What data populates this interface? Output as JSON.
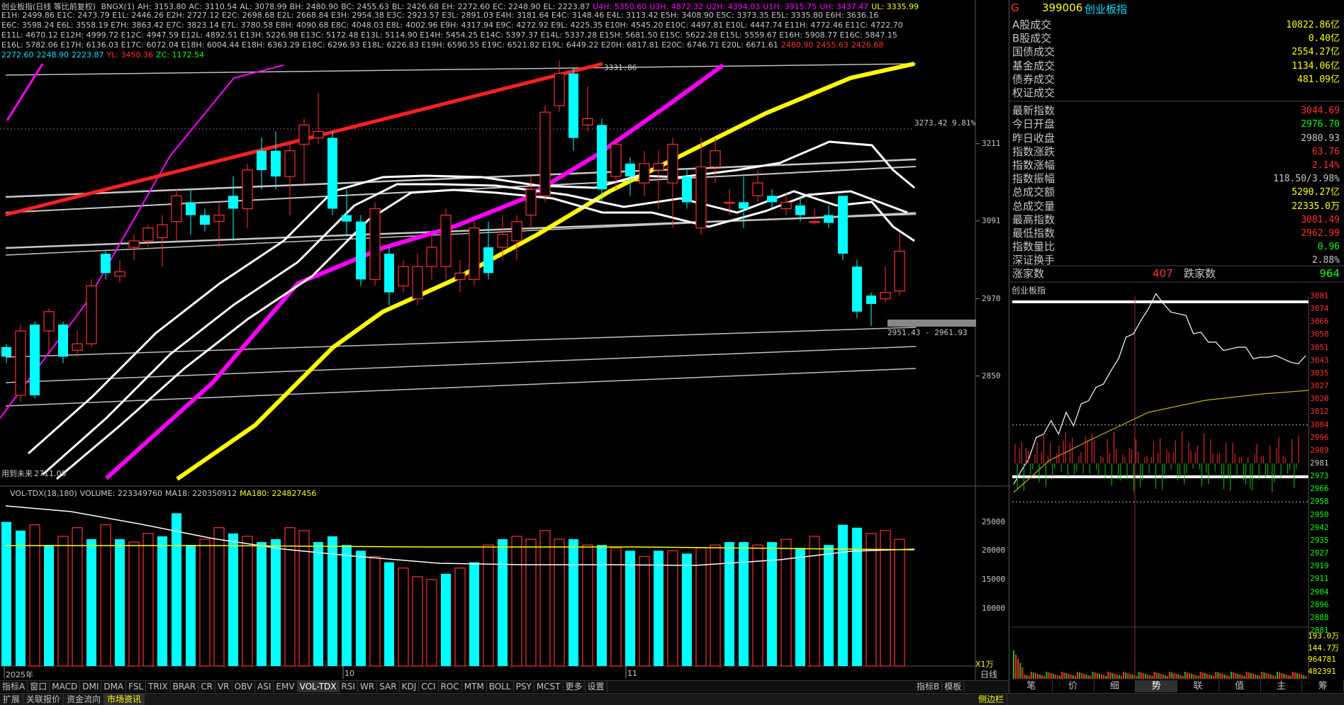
{
  "header": {
    "title": "创业板指(日线 等比前复权)",
    "line1": [
      {
        "t": "BNGX(1)",
        "c": "#c8c8c8"
      },
      {
        "t": "AH: 3153.80",
        "c": "#c8c8c8"
      },
      {
        "t": "AC: 3110.54",
        "c": "#c8c8c8"
      },
      {
        "t": "AL: 3078.99",
        "c": "#c8c8c8"
      },
      {
        "t": "BH: 2480.90",
        "c": "#c8c8c8"
      },
      {
        "t": "BC: 2455.63",
        "c": "#c8c8c8"
      },
      {
        "t": "BL: 2426.68",
        "c": "#c8c8c8"
      },
      {
        "t": "EH: 2272.60",
        "c": "#c8c8c8"
      },
      {
        "t": "EC: 2248.90",
        "c": "#c8c8c8"
      },
      {
        "t": "EL: 2223.87",
        "c": "#c8c8c8"
      },
      {
        "t": "U4H: 5350.60",
        "c": "#ff00ff"
      },
      {
        "t": "U3H: 4872.32",
        "c": "#ff00ff"
      },
      {
        "t": "U2H: 4394.03",
        "c": "#ff00ff"
      },
      {
        "t": "U1H: 3915.75",
        "c": "#ff00ff"
      },
      {
        "t": "UH: 3437.47",
        "c": "#ff00ff"
      },
      {
        "t": "UL: 3335.99",
        "c": "#ffff00"
      }
    ],
    "line2": "E1H: 2499.86 E1C: 2473.79 E1L: 2446.26 E2H: 2727.12 E2C: 2698.68 E2L: 2668.84 E3H: 2954.38 E3C: 2923.57 E3L: 2891.03 E4H: 3181.64 E4C: 3148.46 E4L: 3113.42 E5H: 3408.90 E5C: 3373.35 E5L: 3335.80 E6H: 3636.16",
    "line3": "E6C: 3598.24 E6L: 3558.19 E7H: 3863.42 E7C: 3823.14 E7L: 3780.58 E8H: 4090.68 E8C: 4048.03 E8L: 4002.96 E9H: 4317.94 E9C: 4272.92 E9L: 4225.35 E10H: 4545.20 E10C: 4497.81 E10L: 4447.74 E11H: 4772.46 E11C: 4722.70",
    "line4": "E11L: 4670.12 E12H: 4999.72 E12C: 4947.59 E12L: 4892.51 E13H: 5226.98 E13C: 5172.48 E13L: 5114.90 E14H: 5454.25 E14C: 5397.37 E14L: 5337.28 E15H: 5681.50 E15C: 5622.28 E15L: 5559.67 E16H: 5908.77 E16C: 5847.15",
    "line5": "E16L: 5782.06 E17H: 6136.03 E17C: 6072.04 E18H: 6004.44 E18H: 6363.29 E18C: 6296.93 E18L: 6226.83 E19H: 6590.55 E19C: 6521.82 E19L: 6449.22 E20H: 6817.81 E20C: 6746.71 E20L: 6671.61",
    "line5_tail": [
      {
        "t": "2480.90",
        "c": "#ff3030"
      },
      {
        "t": "2455.63",
        "c": "#ff3030"
      },
      {
        "t": "2426.68",
        "c": "#ff3030"
      }
    ],
    "line6": [
      {
        "t": "2272.60",
        "c": "#00e0ff"
      },
      {
        "t": "2248.90",
        "c": "#00e0ff"
      },
      {
        "t": "2223.87",
        "c": "#00e0ff"
      },
      {
        "t": "YL: 3450.36",
        "c": "#ff3030"
      },
      {
        "t": "ZC: 1172.54",
        "c": "#00ff00"
      }
    ]
  },
  "price_axis": [
    "3211",
    "3091",
    "2970",
    "2850"
  ],
  "annotations": {
    "high_label": "3331.86",
    "target_label": "3273.42 9.81%",
    "range_label": "2951.43 - 2961.93",
    "left_note": "用到未来",
    "left_value": "2711.08"
  },
  "volume": {
    "header": [
      {
        "t": "VOL-TDX(18,180)",
        "c": "#c8c8c8"
      },
      {
        "t": "VOLUME: 223349760",
        "c": "#c8c8c8"
      },
      {
        "t": "MA18: 220350912",
        "c": "#c8c8c8"
      },
      {
        "t": "MA180: 224827456",
        "c": "#ffff00"
      }
    ],
    "axis": [
      "25000",
      "20000",
      "15000",
      "10000"
    ],
    "unit": "X1万"
  },
  "date_axis": [
    "2025年",
    "10",
    "11"
  ],
  "candles": [
    {
      "o": 2895,
      "c": 2880,
      "h": 2900,
      "l": 2870
    },
    {
      "o": 2820,
      "c": 2920,
      "h": 2930,
      "l": 2810
    },
    {
      "o": 2930,
      "c": 2820,
      "h": 2935,
      "l": 2815
    },
    {
      "o": 2920,
      "c": 2950,
      "h": 2955,
      "l": 2885
    },
    {
      "o": 2930,
      "c": 2880,
      "h": 2935,
      "l": 2870
    },
    {
      "o": 2890,
      "c": 2900,
      "h": 2920,
      "l": 2880
    },
    {
      "o": 2900,
      "c": 2990,
      "h": 3000,
      "l": 2895
    },
    {
      "o": 3040,
      "c": 3010,
      "h": 3045,
      "l": 3000
    },
    {
      "o": 3005,
      "c": 3012,
      "h": 3030,
      "l": 2995
    },
    {
      "o": 3050,
      "c": 3060,
      "h": 3070,
      "l": 3030
    },
    {
      "o": 3060,
      "c": 3080,
      "h": 3085,
      "l": 3050
    },
    {
      "o": 3065,
      "c": 3085,
      "h": 3100,
      "l": 3020
    },
    {
      "o": 3090,
      "c": 3130,
      "h": 3140,
      "l": 3060
    },
    {
      "o": 3120,
      "c": 3100,
      "h": 3140,
      "l": 3070
    },
    {
      "o": 3100,
      "c": 3085,
      "h": 3110,
      "l": 3075
    },
    {
      "o": 3090,
      "c": 3100,
      "h": 3120,
      "l": 3050
    },
    {
      "o": 3130,
      "c": 3110,
      "h": 3160,
      "l": 3060
    },
    {
      "o": 3110,
      "c": 3170,
      "h": 3180,
      "l": 3080
    },
    {
      "o": 3200,
      "c": 3170,
      "h": 3220,
      "l": 3140
    },
    {
      "o": 3200,
      "c": 3160,
      "h": 3230,
      "l": 3140
    },
    {
      "o": 3160,
      "c": 3200,
      "h": 3210,
      "l": 3100
    },
    {
      "o": 3210,
      "c": 3240,
      "h": 3250,
      "l": 3150
    },
    {
      "o": 3220,
      "c": 3230,
      "h": 3290,
      "l": 3210
    },
    {
      "o": 3220,
      "c": 3110,
      "h": 3230,
      "l": 3100
    },
    {
      "o": 3100,
      "c": 3090,
      "h": 3140,
      "l": 3070
    },
    {
      "o": 3090,
      "c": 3000,
      "h": 3100,
      "l": 2990
    },
    {
      "o": 3000,
      "c": 3110,
      "h": 3120,
      "l": 2990
    },
    {
      "o": 3040,
      "c": 2980,
      "h": 3050,
      "l": 2960
    },
    {
      "o": 2990,
      "c": 3020,
      "h": 3030,
      "l": 2980
    },
    {
      "o": 2970,
      "c": 3020,
      "h": 3040,
      "l": 2960
    },
    {
      "o": 3020,
      "c": 3050,
      "h": 3070,
      "l": 3000
    },
    {
      "o": 3020,
      "c": 3100,
      "h": 3110,
      "l": 3000
    },
    {
      "o": 3000,
      "c": 3010,
      "h": 3030,
      "l": 2980
    },
    {
      "o": 3000,
      "c": 3080,
      "h": 3090,
      "l": 2990
    },
    {
      "o": 3050,
      "c": 3010,
      "h": 3090,
      "l": 3000
    },
    {
      "o": 3050,
      "c": 3070,
      "h": 3100,
      "l": 3030
    },
    {
      "o": 3060,
      "c": 3090,
      "h": 3100,
      "l": 3030
    },
    {
      "o": 3100,
      "c": 3140,
      "h": 3160,
      "l": 3080
    },
    {
      "o": 3130,
      "c": 3260,
      "h": 3270,
      "l": 3120
    },
    {
      "o": 3270,
      "c": 3320,
      "h": 3340,
      "l": 3260
    },
    {
      "o": 3320,
      "c": 3220,
      "h": 3330,
      "l": 3200
    },
    {
      "o": 3240,
      "c": 3250,
      "h": 3300,
      "l": 3230
    },
    {
      "o": 3240,
      "c": 3140,
      "h": 3250,
      "l": 3120
    },
    {
      "o": 3160,
      "c": 3210,
      "h": 3220,
      "l": 3140
    },
    {
      "o": 3180,
      "c": 3160,
      "h": 3190,
      "l": 3130
    },
    {
      "o": 3150,
      "c": 3180,
      "h": 3200,
      "l": 3130
    },
    {
      "o": 3170,
      "c": 3180,
      "h": 3200,
      "l": 3110
    },
    {
      "o": 3150,
      "c": 3210,
      "h": 3220,
      "l": 3080
    },
    {
      "o": 3160,
      "c": 3120,
      "h": 3170,
      "l": 3110
    },
    {
      "o": 3080,
      "c": 3175,
      "h": 3220,
      "l": 3070
    },
    {
      "o": 3175,
      "c": 3200,
      "h": 3220,
      "l": 3150
    },
    {
      "o": 3120,
      "c": 3120,
      "h": 3140,
      "l": 3100
    },
    {
      "o": 3120,
      "c": 3110,
      "h": 3160,
      "l": 3080
    },
    {
      "o": 3130,
      "c": 3150,
      "h": 3170,
      "l": 3120
    },
    {
      "o": 3130,
      "c": 3120,
      "h": 3140,
      "l": 3110
    },
    {
      "o": 3110,
      "c": 3120,
      "h": 3135,
      "l": 3100
    },
    {
      "o": 3115,
      "c": 3100,
      "h": 3130,
      "l": 3090
    },
    {
      "o": 3090,
      "c": 3090,
      "h": 3110,
      "l": 3085
    },
    {
      "o": 3100,
      "c": 3088,
      "h": 3115,
      "l": 3080
    },
    {
      "o": 3130,
      "c": 3040,
      "h": 3130,
      "l": 3030
    },
    {
      "o": 3020,
      "c": 2950,
      "h": 3030,
      "l": 2940
    },
    {
      "o": 2975,
      "c": 2962,
      "h": 2980,
      "l": 2928
    },
    {
      "o": 2970,
      "c": 2980,
      "h": 3020,
      "l": 2965
    },
    {
      "o": 2982,
      "c": 3044,
      "h": 3072,
      "l": 2975
    }
  ],
  "volumes": [
    25000,
    23500,
    24500,
    21000,
    22500,
    24000,
    22000,
    24500,
    22000,
    21500,
    23000,
    22500,
    26500,
    21000,
    22000,
    24000,
    23000,
    22500,
    21500,
    22000,
    24000,
    23500,
    21500,
    22500,
    21000,
    20000,
    19000,
    18000,
    17000,
    15500,
    15000,
    16000,
    17000,
    18000,
    21000,
    22000,
    22500,
    22000,
    23500,
    22000,
    22000,
    21000,
    21000,
    20500,
    20000,
    19000,
    20000,
    20000,
    19500,
    20500,
    21000,
    21500,
    21500,
    21000,
    21500,
    22000,
    20500,
    22500,
    21000,
    24500,
    24000,
    23000,
    23500,
    22000
  ],
  "vol_up": [
    false,
    false,
    true,
    false,
    true,
    true,
    false,
    true,
    false,
    true,
    true,
    false,
    false,
    false,
    true,
    true,
    false,
    true,
    false,
    false,
    true,
    true,
    false,
    false,
    false,
    false,
    true,
    false,
    true,
    true,
    true,
    false,
    true,
    false,
    true,
    false,
    true,
    true,
    true,
    true,
    false,
    true,
    false,
    true,
    false,
    true,
    false,
    true,
    false,
    true,
    true,
    false,
    false,
    true,
    false,
    true,
    false,
    true,
    false,
    false,
    false,
    true,
    true,
    true
  ],
  "right": {
    "code_prefix": "G",
    "code": "399006",
    "name": "创业板指",
    "rows": [
      {
        "label": "A股成交",
        "val": "10822.86亿",
        "c": "#ffff00"
      },
      {
        "label": "B股成交",
        "val": "0.40亿",
        "c": "#ffff00"
      },
      {
        "label": "国债成交",
        "val": "2554.27亿",
        "c": "#ffff00"
      },
      {
        "label": "基金成交",
        "val": "1134.06亿",
        "c": "#ffff00"
      },
      {
        "label": "债券成交",
        "val": "481.09亿",
        "c": "#ffff00"
      },
      {
        "label": "权证成交",
        "val": "",
        "c": "#ffff00"
      },
      {
        "label": "最新指数",
        "val": "3044.69",
        "c": "#ff3030"
      },
      {
        "label": "今日开盘",
        "val": "2976.70",
        "c": "#00ff00"
      },
      {
        "label": "昨日收盘",
        "val": "2980.93",
        "c": "#c8c8c8"
      },
      {
        "label": "指数涨跌",
        "val": "63.76",
        "c": "#ff3030"
      },
      {
        "label": "指数涨幅",
        "val": "2.14%",
        "c": "#ff3030"
      },
      {
        "label": "指数振幅",
        "val": "118.50/3.98%",
        "c": "#c8c8c8"
      },
      {
        "label": "总成交额",
        "val": "5290.27亿",
        "c": "#ffff00"
      },
      {
        "label": "总成交量",
        "val": "22335.0万",
        "c": "#ffff00"
      },
      {
        "label": "最高指数",
        "val": "3081.49",
        "c": "#ff3030"
      },
      {
        "label": "最低指数",
        "val": "2962.99",
        "c": "#ff3030"
      },
      {
        "label": "指数量比",
        "val": "0.96",
        "c": "#00ff00"
      },
      {
        "label": "深证换手",
        "val": "2.88%",
        "c": "#c8c8c8"
      }
    ],
    "updown": {
      "up_label": "涨家数",
      "up_val": "407",
      "down_label": "跌家数",
      "down_val": "964"
    },
    "intraday_title": "创业板指",
    "intraday_axis": [
      "3081",
      "3074",
      "3066",
      "3058",
      "3051",
      "3043",
      "3035",
      "3027",
      "3020",
      "3012",
      "3004",
      "2996",
      "2989",
      "2981",
      "2973",
      "2966",
      "2958",
      "2950",
      "2942",
      "2935",
      "2927",
      "2919",
      "2911",
      "2904",
      "2896",
      "2888",
      "2881"
    ],
    "intraday_vol_axis": [
      "193.0万",
      "144.7万",
      "964781",
      "482391"
    ],
    "prev_close": 2980.93,
    "intraday_tabs": [
      "笔",
      "价",
      "细",
      "势",
      "联",
      "值",
      "主",
      "筹"
    ],
    "active_intraday_tab": "势"
  },
  "tabs": [
    "指标A",
    "窗口",
    "MACD",
    "DMI",
    "DMA",
    "FSL",
    "TRIX",
    "BRAR",
    "CR",
    "VR",
    "OBV",
    "ASI",
    "EMV",
    "VOL-TDX",
    "RSI",
    "WR",
    "SAR",
    "KDJ",
    "CCI",
    "ROC",
    "MTM",
    "BOLL",
    "PSY",
    "MCST",
    "更多",
    "设置"
  ],
  "active_tab": "VOL-TDX",
  "tabs_right": [
    "指标B",
    "模板"
  ],
  "bottom": [
    "扩展",
    "关联报价",
    "资金流向",
    "市场资讯"
  ],
  "bottom_active": "市场资讯",
  "bottom_right": "侧边栏",
  "daily_label": "日线"
}
